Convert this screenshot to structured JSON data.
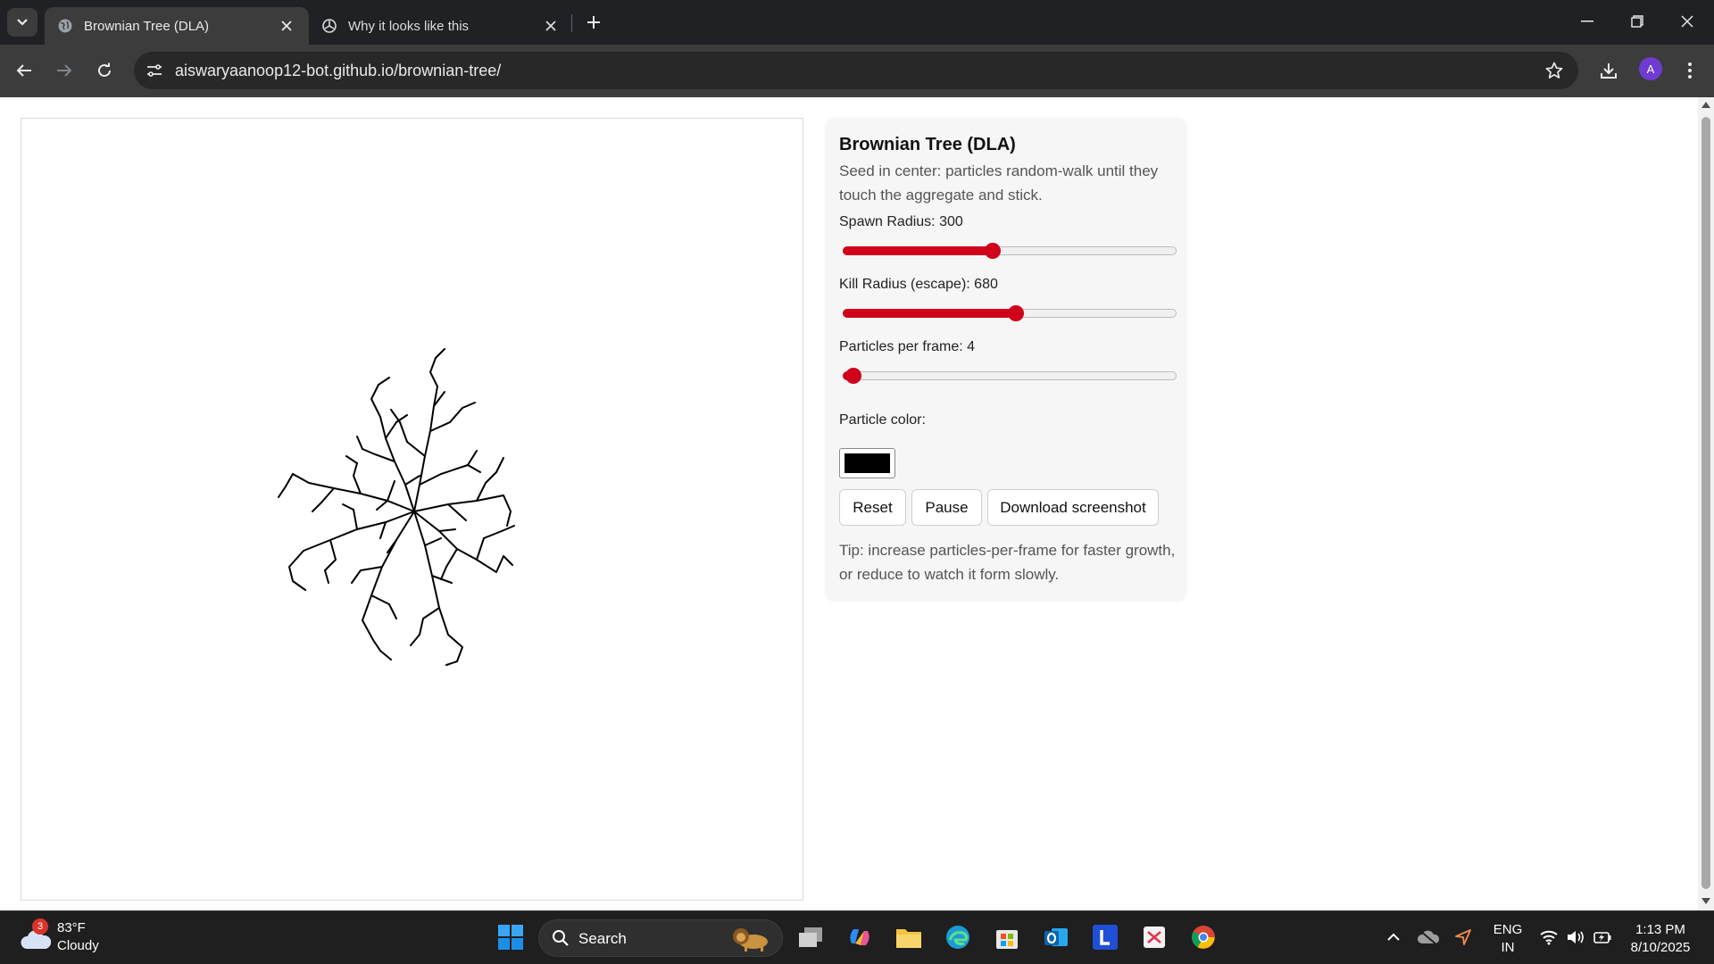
{
  "browser": {
    "tabs": [
      {
        "title": "Brownian Tree (DLA)",
        "active": true
      },
      {
        "title": "Why it looks like this",
        "active": false
      }
    ],
    "url": "aiswaryaanoop12-bot.github.io/brownian-tree/",
    "profile_initial": "A"
  },
  "panel": {
    "title": "Brownian Tree (DLA)",
    "description": "Seed in center: particles random-walk until they touch the aggregate and stick.",
    "spawn_label": "Spawn Radius: 300",
    "spawn_fraction": 0.45,
    "kill_label": "Kill Radius (escape): 680",
    "kill_fraction": 0.52,
    "ppf_label": "Particles per frame: 4",
    "ppf_fraction": 0.03,
    "color_label": "Particle color:",
    "particle_color": "#000000",
    "buttons": {
      "reset": "Reset",
      "pause": "Pause",
      "download": "Download screenshot"
    },
    "tip": "Tip: increase particles-per-frame for faster growth, or reduce to watch it form slowly."
  },
  "accent_color": "#d0021b",
  "taskbar": {
    "weather_temp": "83°F",
    "weather_cond": "Cloudy",
    "weather_badge": "3",
    "search_label": "Search",
    "lang_top": "ENG",
    "lang_bottom": "IN",
    "time": "1:13 PM",
    "date": "8/10/2025",
    "apps": [
      "task-view",
      "copilot",
      "file-explorer",
      "edge",
      "microsoft-store",
      "outlook",
      "l-app",
      "snipping-tool",
      "chrome"
    ]
  }
}
